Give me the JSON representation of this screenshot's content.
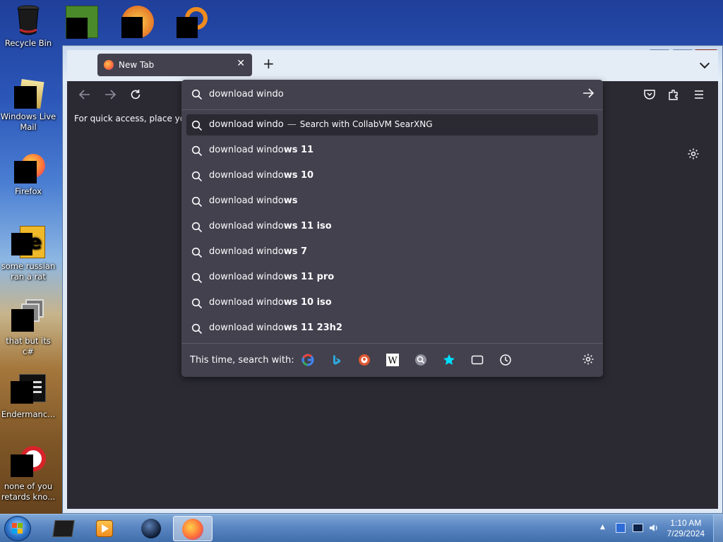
{
  "desktop": {
    "icons": [
      {
        "label": "Recycle Bin"
      },
      {
        "label": "Windows Live Mail"
      },
      {
        "label": "Firefox"
      },
      {
        "label": "some russian ran a rat"
      },
      {
        "label": "that but its c#"
      },
      {
        "label": "Endermanc..."
      },
      {
        "label": "none of you retards kno..."
      }
    ]
  },
  "browser": {
    "tab": {
      "title": "New Tab"
    },
    "bookmarks_hint": "For quick access, place your l",
    "urlbar": {
      "value": "download windo",
      "first": {
        "typed": "download windo",
        "separator": "—",
        "engine_text": "Search with CollabVM SearXNG"
      },
      "suggestions": [
        {
          "prefix": "download windo",
          "rest": "ws 11"
        },
        {
          "prefix": "download windo",
          "rest": "ws 10"
        },
        {
          "prefix": "download windo",
          "rest": "ws"
        },
        {
          "prefix": "download windo",
          "rest": "ws 11 iso"
        },
        {
          "prefix": "download windo",
          "rest": "ws 7"
        },
        {
          "prefix": "download windo",
          "rest": "ws 11 pro"
        },
        {
          "prefix": "download windo",
          "rest": "ws 10 iso"
        },
        {
          "prefix": "download windo",
          "rest": "ws 11 23h2"
        }
      ],
      "footer_label": "This time, search with:"
    }
  },
  "taskbar": {
    "time": "1:10 AM",
    "date": "7/29/2024"
  },
  "icons": {
    "search": "magnifier-icon",
    "back": "arrow-left-icon",
    "forward": "arrow-right-icon",
    "reload": "reload-icon",
    "go": "arrow-right-icon",
    "settings": "gear-icon"
  },
  "colors": {
    "browser_bg": "#2b2a33",
    "panel_bg": "#42414d",
    "text": "#fbfbfe"
  }
}
